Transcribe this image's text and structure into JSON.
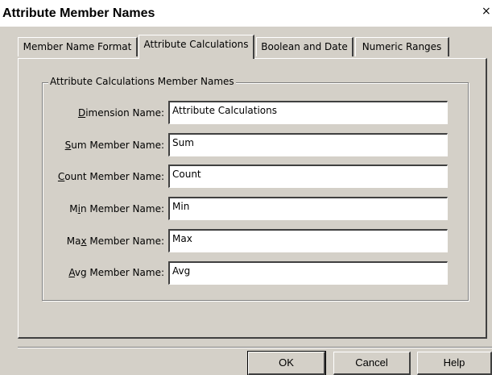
{
  "window": {
    "title": "Attribute Member Names",
    "close_glyph": "×"
  },
  "tabs": [
    {
      "label": "Member Name Format",
      "active": false
    },
    {
      "label": "Attribute Calculations",
      "active": true
    },
    {
      "label": "Boolean and Date",
      "active": false
    },
    {
      "label": "Numeric Ranges",
      "active": false
    }
  ],
  "group": {
    "legend": "Attribute Calculations Member Names"
  },
  "fields": [
    {
      "mnemonic": "D",
      "label_rest": "imension Name:",
      "value": "Attribute Calculations"
    },
    {
      "mnemonic": "S",
      "label_rest": "um Member Name:",
      "value": "Sum"
    },
    {
      "mnemonic": "C",
      "label_rest": "ount Member Name:",
      "value": "Count"
    },
    {
      "label_pre": "M",
      "mnemonic": "i",
      "label_rest": "n Member Name:",
      "value": "Min"
    },
    {
      "label_pre": "Ma",
      "mnemonic": "x",
      "label_rest": " Member Name:",
      "value": "Max"
    },
    {
      "mnemonic": "A",
      "label_rest": "vg Member Name:",
      "value": "Avg"
    }
  ],
  "buttons": {
    "ok": "OK",
    "cancel": "Cancel",
    "help": "Help"
  }
}
